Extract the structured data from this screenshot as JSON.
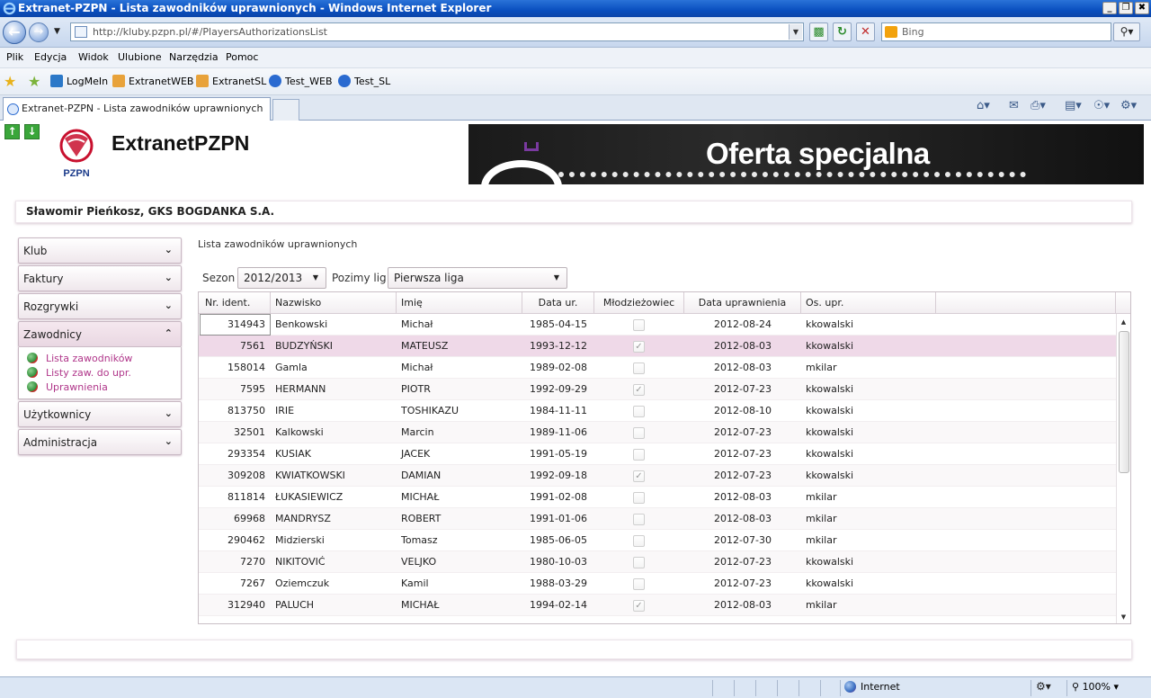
{
  "window": {
    "title": "Extranet-PZPN - Lista zawodników uprawnionych - Windows Internet Explorer",
    "minimize": "_",
    "maximize": "❐",
    "close": "✖"
  },
  "navbar": {
    "url": "http://kluby.pzpn.pl/#/PlayersAuthorizationsList",
    "search_placeholder": "Bing"
  },
  "menu": [
    "Plik",
    "Edycja",
    "Widok",
    "Ulubione",
    "Narzędzia",
    "Pomoc"
  ],
  "favorites": [
    {
      "label": "LogMeIn",
      "icon": "logmein-icon",
      "color": "#2b78c8"
    },
    {
      "label": "ExtranetWEB",
      "icon": "web-slice-icon",
      "color": "#e8a23a"
    },
    {
      "label": "ExtranetSL",
      "icon": "web-slice-icon",
      "color": "#e8a23a"
    },
    {
      "label": "Test_WEB",
      "icon": "ie-page-icon",
      "color": "#2a6ad0"
    },
    {
      "label": "Test_SL",
      "icon": "ie-page-icon",
      "color": "#2a6ad0"
    }
  ],
  "tab": {
    "title": "Extranet-PZPN - Lista zawodników uprawnionych"
  },
  "site": {
    "brand": "ExtranetPZPN",
    "logo_text": "PZPN",
    "banner_text": "Oferta specjalna",
    "user": "Sławomir Pieńkosz, GKS BOGDANKA S.A."
  },
  "sidebar": {
    "items": [
      {
        "label": "Klub",
        "chevron": "⌄"
      },
      {
        "label": "Faktury",
        "chevron": "⌄"
      },
      {
        "label": "Rozgrywki",
        "chevron": "⌄"
      },
      {
        "label": "Zawodnicy",
        "chevron": "⌃"
      },
      {
        "label": "Użytkownicy",
        "chevron": "⌄"
      },
      {
        "label": "Administracja",
        "chevron": "⌄"
      }
    ],
    "submenu": [
      "Lista zawodników",
      "Listy zaw. do upr.",
      "Uprawnienia"
    ]
  },
  "content": {
    "title": "Lista zawodników uprawnionych",
    "season_label": "Sezon",
    "season_value": "2012/2013",
    "level_label": "Pozimy lig",
    "level_value": "Pierwsza liga"
  },
  "grid": {
    "columns": [
      "Nr. ident.",
      "Nazwisko",
      "Imię",
      "Data ur.",
      "Młodzieżowiec",
      "Data uprawnienia",
      "Os. upr."
    ],
    "rows": [
      [
        "314943",
        "Benkowski",
        "Michał",
        "1985-04-15",
        false,
        "2012-08-24",
        "kkowalski"
      ],
      [
        "7561",
        "BUDZYŃSKI",
        "MATEUSZ",
        "1993-12-12",
        true,
        "2012-08-03",
        "kkowalski"
      ],
      [
        "158014",
        "Gamla",
        "Michał",
        "1989-02-08",
        false,
        "2012-08-03",
        "mkilar"
      ],
      [
        "7595",
        "HERMANN",
        "PIOTR",
        "1992-09-29",
        true,
        "2012-07-23",
        "kkowalski"
      ],
      [
        "813750",
        "IRIE",
        "TOSHIKAZU",
        "1984-11-11",
        false,
        "2012-08-10",
        "kkowalski"
      ],
      [
        "32501",
        "Kalkowski",
        "Marcin",
        "1989-11-06",
        false,
        "2012-07-23",
        "kkowalski"
      ],
      [
        "293354",
        "KUSIAK",
        "JACEK",
        "1991-05-19",
        false,
        "2012-07-23",
        "kkowalski"
      ],
      [
        "309208",
        "KWIATKOWSKI",
        "DAMIAN",
        "1992-09-18",
        true,
        "2012-07-23",
        "kkowalski"
      ],
      [
        "811814",
        "ŁUKASIEWICZ",
        "MICHAŁ",
        "1991-02-08",
        false,
        "2012-08-03",
        "mkilar"
      ],
      [
        "69968",
        "MANDRYSZ",
        "ROBERT",
        "1991-01-06",
        false,
        "2012-08-03",
        "mkilar"
      ],
      [
        "290462",
        "Midzierski",
        "Tomasz",
        "1985-06-05",
        false,
        "2012-07-30",
        "mkilar"
      ],
      [
        "7270",
        "NIKITOVIĆ",
        "VELJKO",
        "1980-10-03",
        false,
        "2012-07-23",
        "kkowalski"
      ],
      [
        "7267",
        "Oziemczuk",
        "Kamil",
        "1988-03-29",
        false,
        "2012-07-23",
        "kkowalski"
      ],
      [
        "312940",
        "PALUCH",
        "MICHAŁ",
        "1994-02-14",
        true,
        "2012-08-03",
        "mkilar"
      ]
    ],
    "selected_row": 1
  },
  "status": {
    "zone": "Internet",
    "zoom": "100%"
  },
  "colors": {
    "accent": "#b0368a",
    "selected_row": "#efd9e8",
    "ie_blue": "#0a4fbf"
  }
}
